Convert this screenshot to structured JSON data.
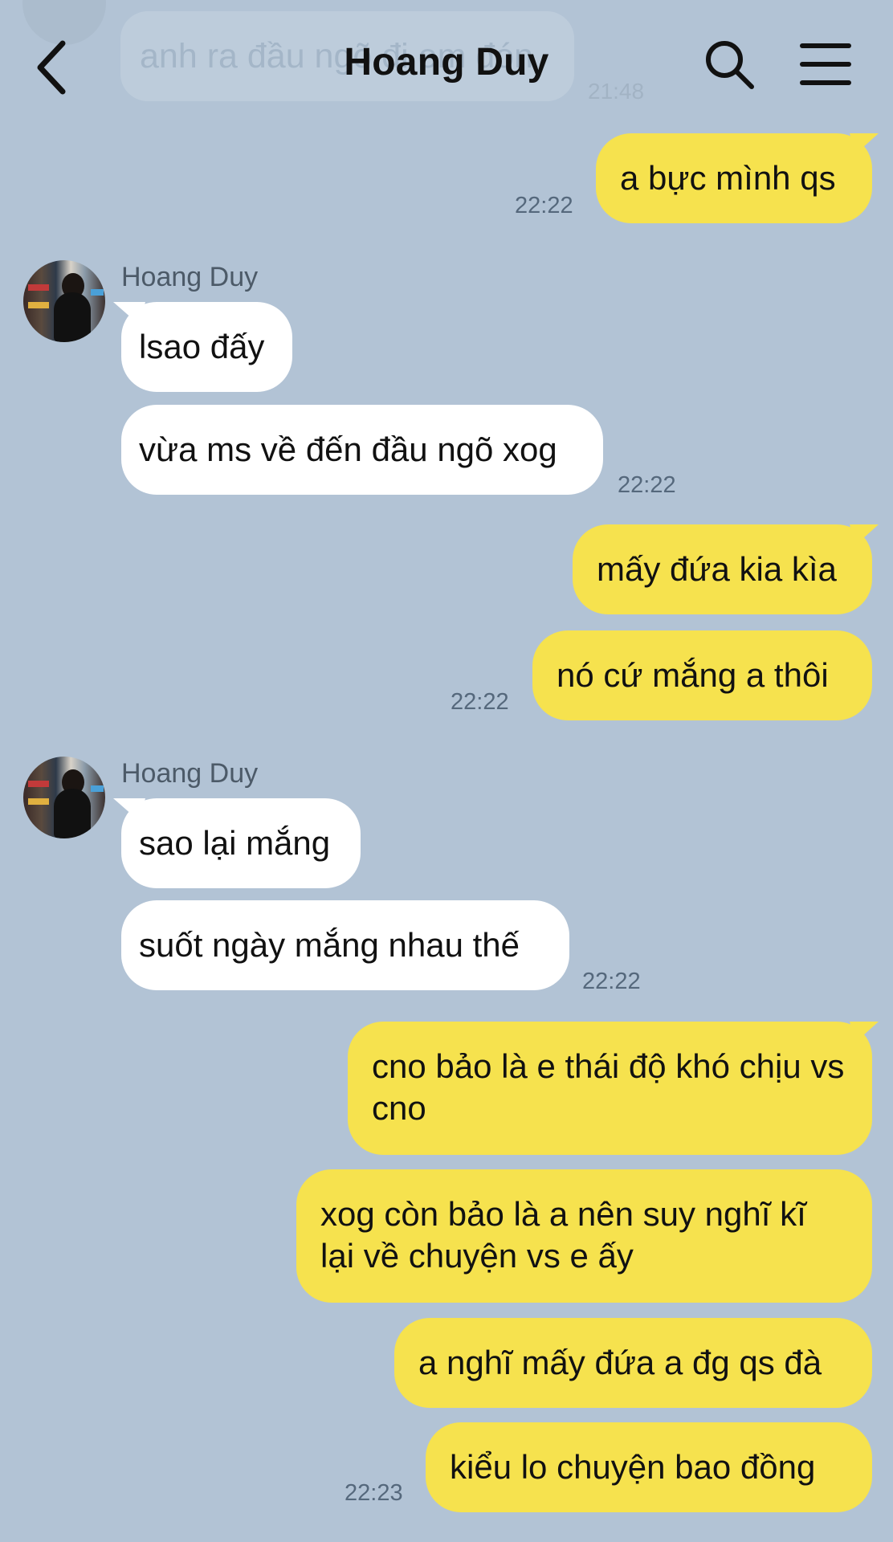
{
  "header": {
    "title": "Hoang Duy",
    "faded_message": "anh ra đầu ngõ đi em đón",
    "faded_time": "21:48"
  },
  "icons": {
    "back": "chevron-left-icon",
    "search": "search-icon",
    "menu": "hamburger-menu-icon"
  },
  "colors": {
    "background": "#b2c3d5",
    "outgoing_bubble": "#f6e24e",
    "incoming_bubble": "#ffffff"
  },
  "messages": [
    {
      "dir": "out",
      "text": "a bực mình qs",
      "time": "22:22"
    },
    {
      "dir": "in",
      "sender": "Hoang Duy",
      "text": "lsao đấy"
    },
    {
      "dir": "in",
      "text": "vừa ms về đến đầu ngõ xog",
      "time": "22:22"
    },
    {
      "dir": "out",
      "text": "mấy đứa kia kìa"
    },
    {
      "dir": "out",
      "text": "nó cứ mắng a thôi",
      "time": "22:22"
    },
    {
      "dir": "in",
      "sender": "Hoang Duy",
      "text": "sao lại mắng"
    },
    {
      "dir": "in",
      "text": "suốt ngày mắng nhau thế",
      "time": "22:22"
    },
    {
      "dir": "out",
      "text": "cno bảo là e thái độ khó chịu vs cno"
    },
    {
      "dir": "out",
      "text": "xog còn bảo là a nên suy nghĩ kĩ lại về chuyện vs e ấy"
    },
    {
      "dir": "out",
      "text": "a nghĩ mấy đứa a đg qs đà"
    },
    {
      "dir": "out",
      "text": "kiểu lo chuyện bao đồng",
      "time": "22:23"
    }
  ]
}
